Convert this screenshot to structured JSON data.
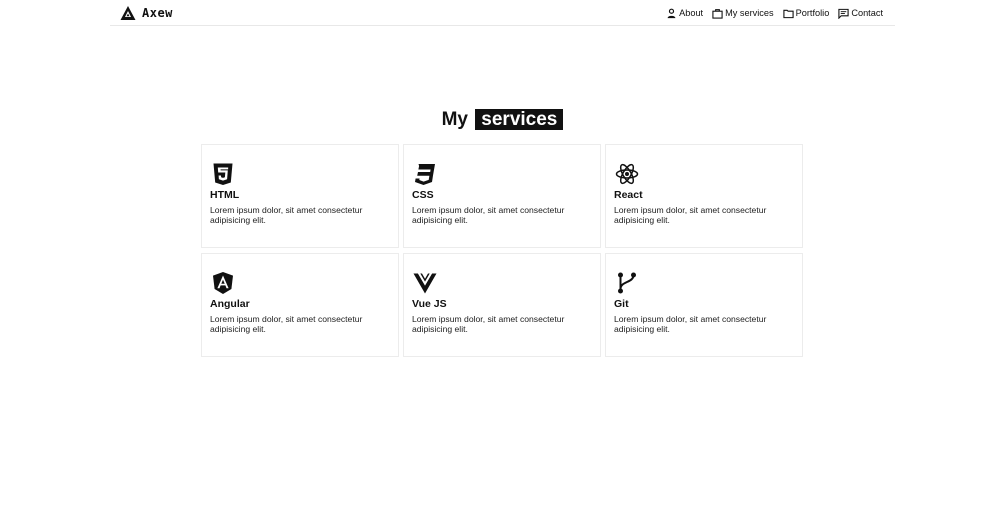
{
  "brand": {
    "name": "Axew",
    "logo_icon": "triangle-logo-icon"
  },
  "nav": {
    "items": [
      {
        "label": "About",
        "icon": "person-icon"
      },
      {
        "label": "My services",
        "icon": "briefcase-icon"
      },
      {
        "label": "Portfolio",
        "icon": "folder-icon"
      },
      {
        "label": "Contact",
        "icon": "chat-icon"
      }
    ]
  },
  "section": {
    "title_prefix": "My",
    "title_highlight": "services"
  },
  "services": [
    {
      "title": "HTML",
      "description": "Lorem ipsum dolor, sit amet consectetur adipisicing elit.",
      "icon": "html5-icon"
    },
    {
      "title": "CSS",
      "description": "Lorem ipsum dolor, sit amet consectetur adipisicing elit.",
      "icon": "css3-icon"
    },
    {
      "title": "React",
      "description": "Lorem ipsum dolor, sit amet consectetur adipisicing elit.",
      "icon": "react-icon"
    },
    {
      "title": "Angular",
      "description": "Lorem ipsum dolor, sit amet consectetur adipisicing elit.",
      "icon": "angular-icon"
    },
    {
      "title": "Vue JS",
      "description": "Lorem ipsum dolor, sit amet consectetur adipisicing elit.",
      "icon": "vue-icon"
    },
    {
      "title": "Git",
      "description": "Lorem ipsum dolor, sit amet consectetur adipisicing elit.",
      "icon": "git-branch-icon"
    }
  ],
  "colors": {
    "text": "#111111",
    "highlight_bg": "#111111",
    "highlight_text": "#ffffff",
    "card_border": "#ececec"
  }
}
